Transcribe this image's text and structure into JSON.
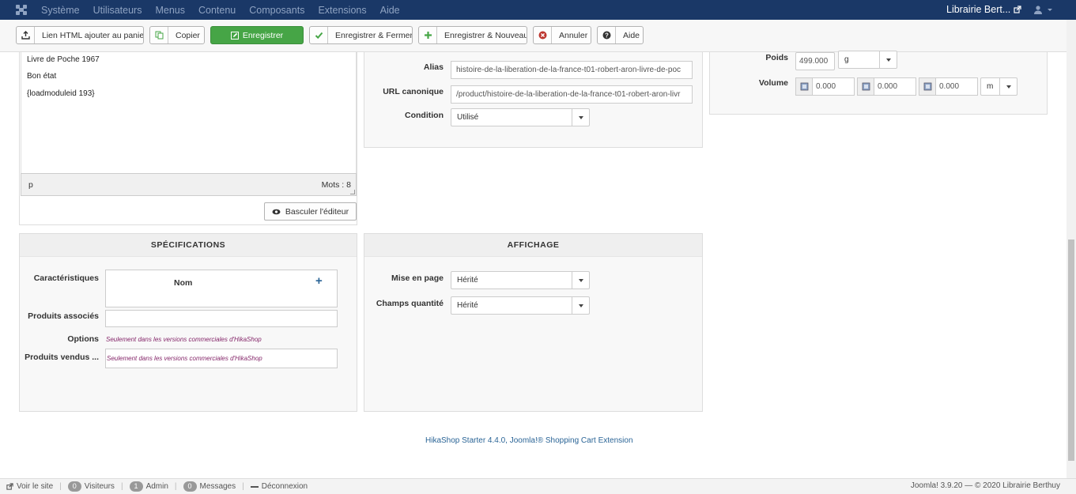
{
  "navbar": {
    "menu": [
      "Système",
      "Utilisateurs",
      "Menus",
      "Contenu",
      "Composants",
      "Extensions",
      "Aide"
    ],
    "site_name": "Librairie Bert...",
    "icons": {
      "logo": "joomla-logo-icon",
      "external": "external-link-icon",
      "user": "user-icon"
    }
  },
  "toolbar": {
    "link_html": "Lien HTML ajouter au panier",
    "copy": "Copier",
    "save": "Enregistrer",
    "save_close": "Enregistrer & Fermer",
    "save_new": "Enregistrer & Nouveau",
    "cancel": "Annuler",
    "help": "Aide"
  },
  "editor": {
    "lines": [
      "Livre de Poche 1967",
      "Bon état",
      "{loadmoduleid 193}"
    ],
    "path": "p",
    "word_count": "Mots : 8",
    "toggle_label": "Basculer l'éditeur"
  },
  "general": {
    "alias_label": "Alias",
    "alias_value": "histoire-de-la-liberation-de-la-france-t01-robert-aron-livre-de-poc",
    "canonical_label": "URL canonique",
    "canonical_value": "/product/histoire-de-la-liberation-de-la-france-t01-robert-aron-livr",
    "condition_label": "Condition",
    "condition_value": "Utilisé"
  },
  "dimensions": {
    "weight_label": "Poids",
    "weight_value": "499.000",
    "weight_unit": "g",
    "volume_label": "Volume",
    "volume_values": [
      "0.000",
      "0.000",
      "0.000"
    ],
    "volume_unit": "m"
  },
  "specifications": {
    "title": "SPÉCIFICATIONS",
    "characteristics_label": "Caractéristiques",
    "name_header": "Nom",
    "add_symbol": "+",
    "related_label": "Produits associés",
    "options_label": "Options",
    "options_note": "Seulement dans les versions commerciales d'HikaShop",
    "sold_label": "Produits vendus ...",
    "sold_note": "Seulement dans les versions commerciales d'HikaShop"
  },
  "display": {
    "title": "AFFICHAGE",
    "layout_label": "Mise en page",
    "layout_value": "Hérité",
    "qty_label": "Champs quantité",
    "qty_value": "Hérité"
  },
  "footer_link": "HikaShop Starter 4.4.0, Joomla!® Shopping Cart Extension",
  "statusbar": {
    "view_site": "Voir le site",
    "visitors_count": "0",
    "visitors": "Visiteurs",
    "admin_count": "1",
    "admin": "Admin",
    "messages_count": "0",
    "messages": "Messages",
    "logout": "Déconnexion",
    "copyright": "Joomla! 3.9.20  —  © 2020 Librairie Berthuy"
  },
  "colors": {
    "navbar": "#1a3867",
    "save_green": "#46a546",
    "link_blue": "#2a6496",
    "note_purple": "#85276a"
  }
}
